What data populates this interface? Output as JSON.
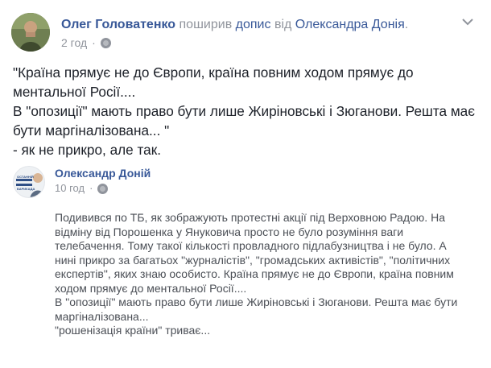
{
  "post": {
    "author": "Олег Головатенко",
    "action": "поширив",
    "action_object": "допис",
    "preposition": "від",
    "shared_from": "Олександра Донія",
    "period": ".",
    "time": "2 год",
    "dot": "·",
    "privacy_icon": "globe-icon",
    "menu_icon": "chevron-down-icon",
    "text_lines": [
      "\"Країна прямує не до Європи, країна повним ходом прямує до",
      "ментальної Росії....",
      "В \"опозиції\" мають право бути лише Жиріновські і Зюганови. Решта має",
      "бути маргіналізована... \"",
      "- як не прикро, але так."
    ]
  },
  "shared_post": {
    "author": "Олександр Доній",
    "time": "10 год",
    "dot": "·",
    "privacy_icon": "globe-icon",
    "avatar_text": [
      "ОСТАННІЙ",
      "БАРИКАДА"
    ],
    "text_lines": [
      "Подивився по ТБ, як зображують протестні акції під Верховною Радою. На",
      "відміну від Порошенка у Януковича просто не було розуміння ваги",
      "телебачення. Тому такої кількості провладного підлабузництва і не було. А",
      "нині прикро за багатьох \"журналістів\", \"громадських активістів\", \"політичних",
      "експертів\", яких знаю особисто. Країна прямує не до Європи, країна повним",
      "ходом прямує до ментальної Росії....",
      "В \"опозиції\" мають право бути лише Жиріновські і Зюганови. Решта має бути",
      "маргіналізована...",
      "\"рошенізація країни\" триває..."
    ]
  },
  "colors": {
    "link": "#385898",
    "muted": "#90949c",
    "text": "#1d2129",
    "shared_text": "#4b4f56"
  }
}
